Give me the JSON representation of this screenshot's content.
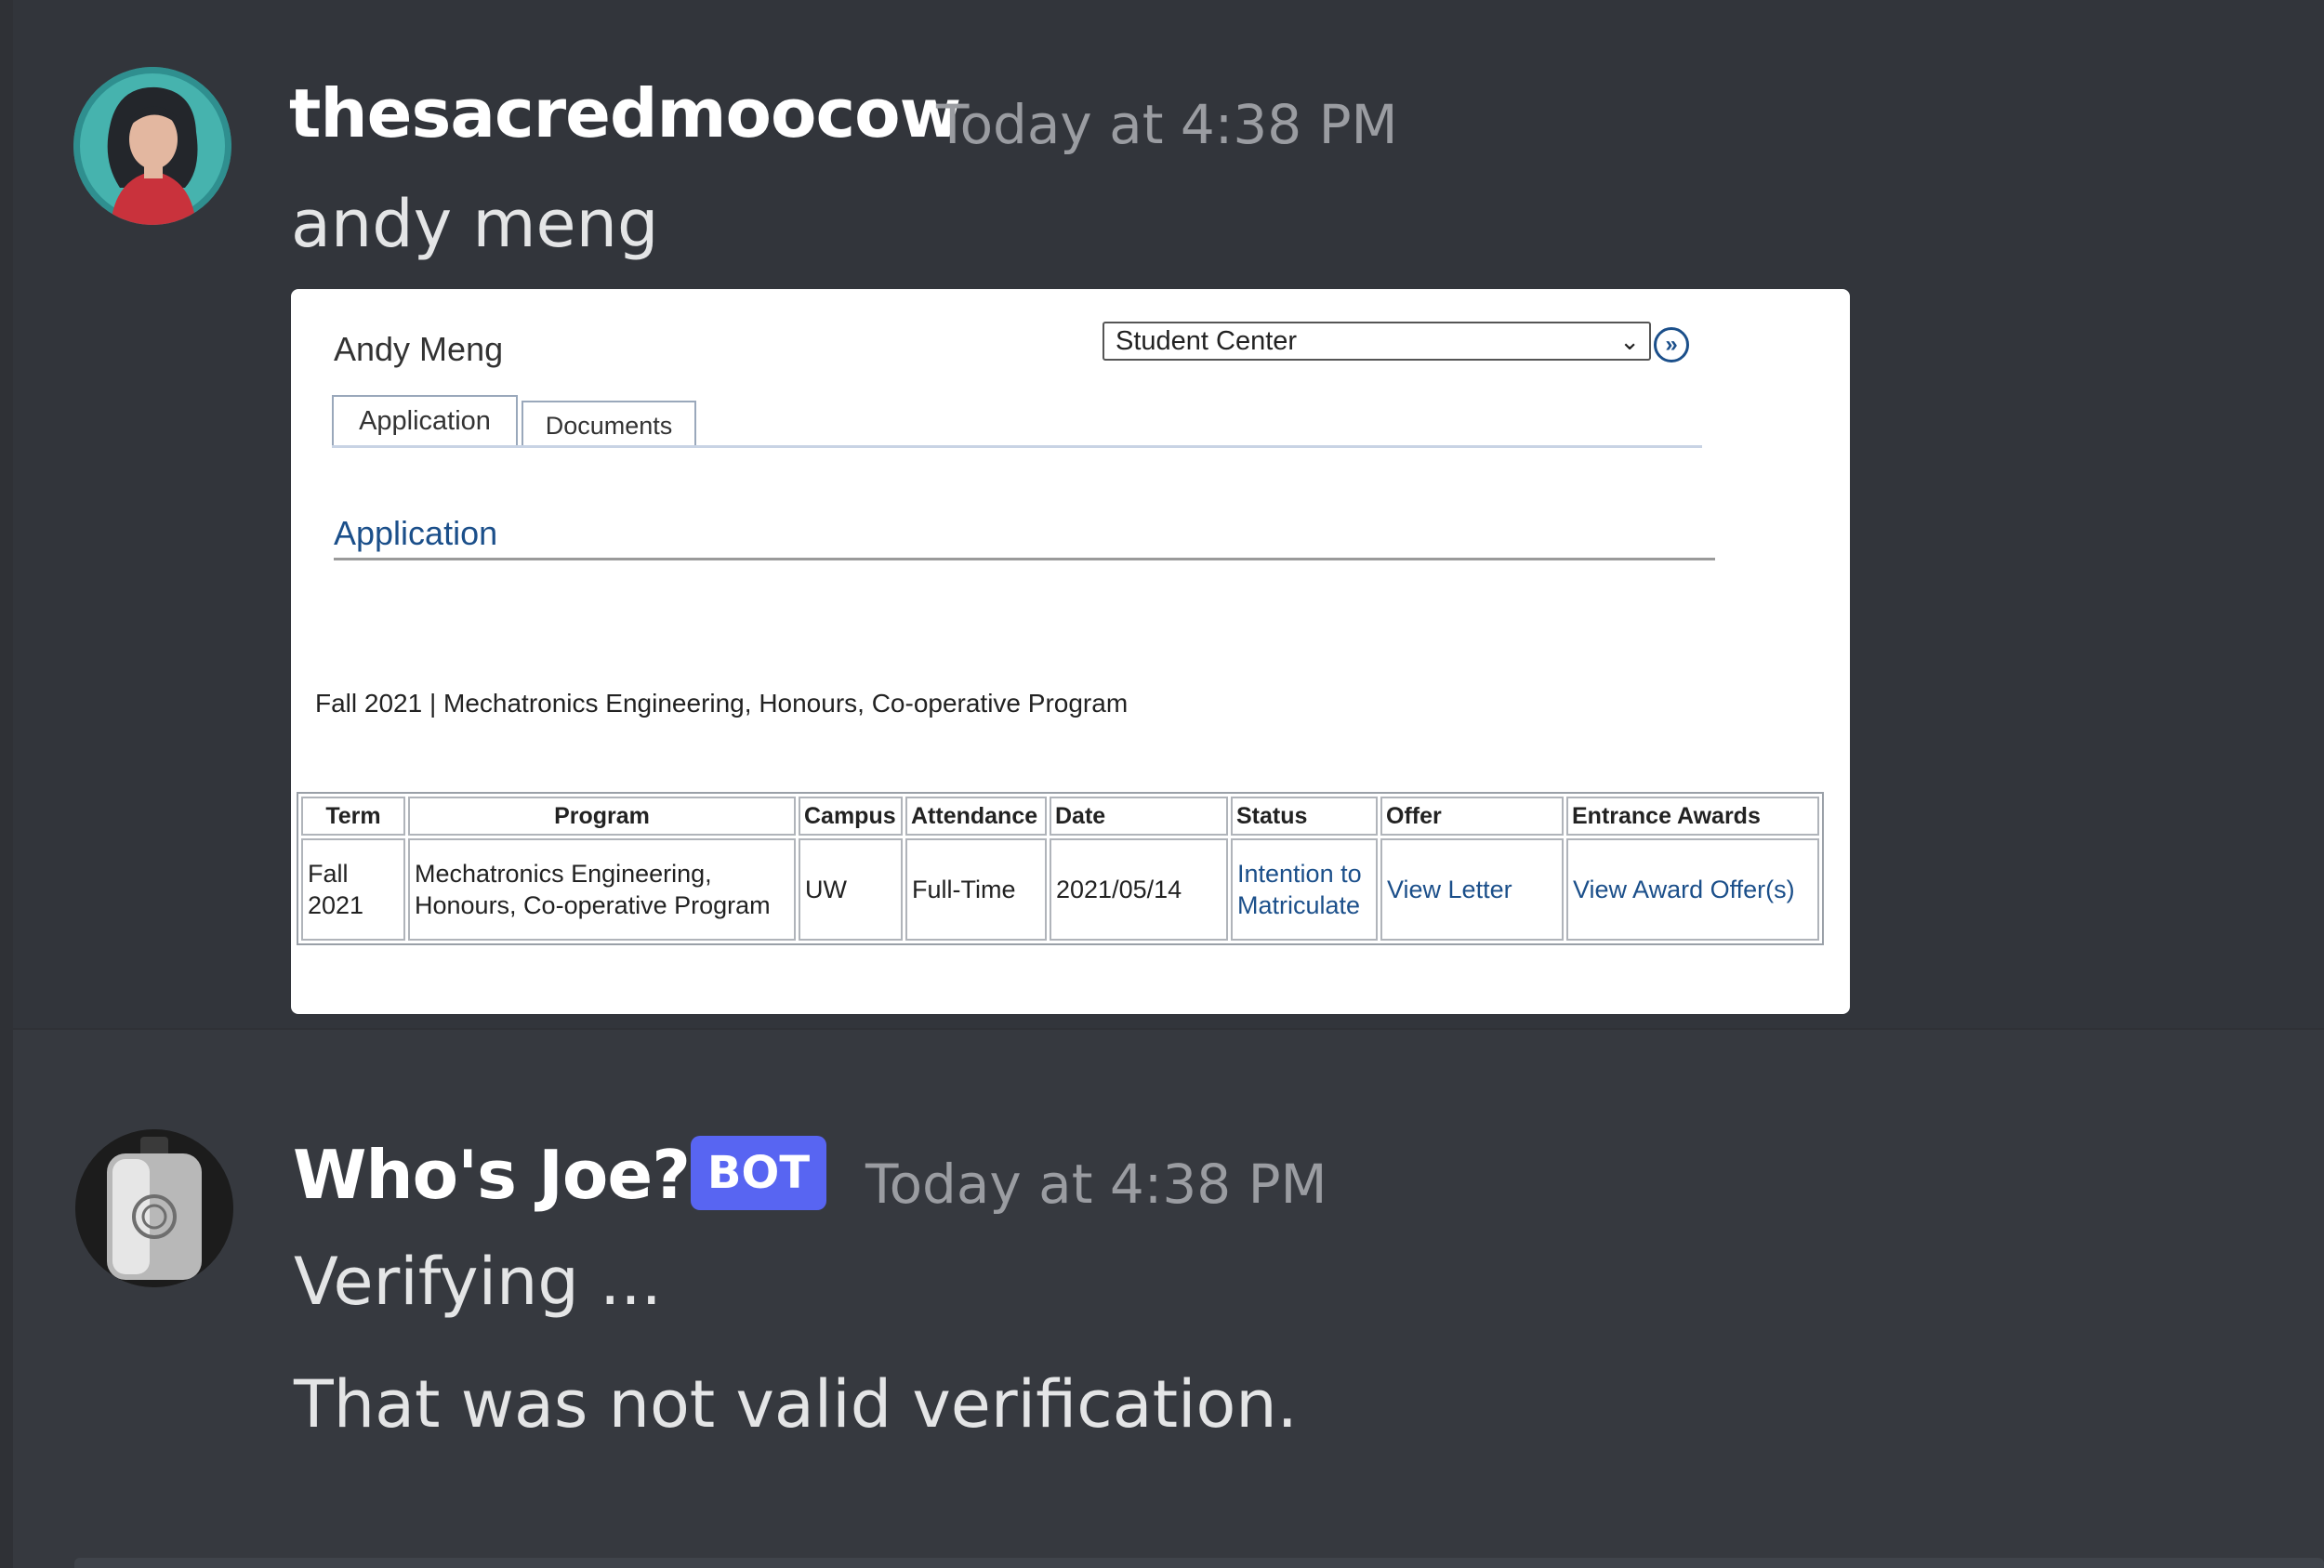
{
  "messages": [
    {
      "author": "thesacredmoocow",
      "timestamp": "Today at 4:38 PM",
      "text": "andy meng",
      "avatar_icon": "user-avatar",
      "attachment": {
        "student_name": "Andy Meng",
        "nav_select": "Student Center",
        "tabs": [
          "Application",
          "Documents"
        ],
        "section_heading": "Application",
        "program_summary": "Fall 2021 | Mechatronics Engineering, Honours, Co-operative Program",
        "table": {
          "headers": [
            "Term",
            "Program",
            "Campus",
            "Attendance",
            "Date",
            "Status",
            "Offer",
            "Entrance Awards"
          ],
          "row": {
            "term": "Fall 2021",
            "program": "Mechatronics Engineering, Honours, Co-operative Program",
            "campus": "UW",
            "attendance": "Full-Time",
            "date": "2021/05/14",
            "status": "Intention to Matriculate",
            "offer": "View Letter",
            "awards": "View Award Offer(s)"
          }
        }
      }
    },
    {
      "author": "Who's Joe?",
      "badge": "BOT",
      "timestamp": "Today at 4:38 PM",
      "avatar_icon": "flask-avatar",
      "lines": [
        "Verifying ...",
        "That was not valid verification."
      ]
    }
  ],
  "colors": {
    "background": "#36393f",
    "badge": "#5865f2",
    "link": "#1b4f8a"
  }
}
